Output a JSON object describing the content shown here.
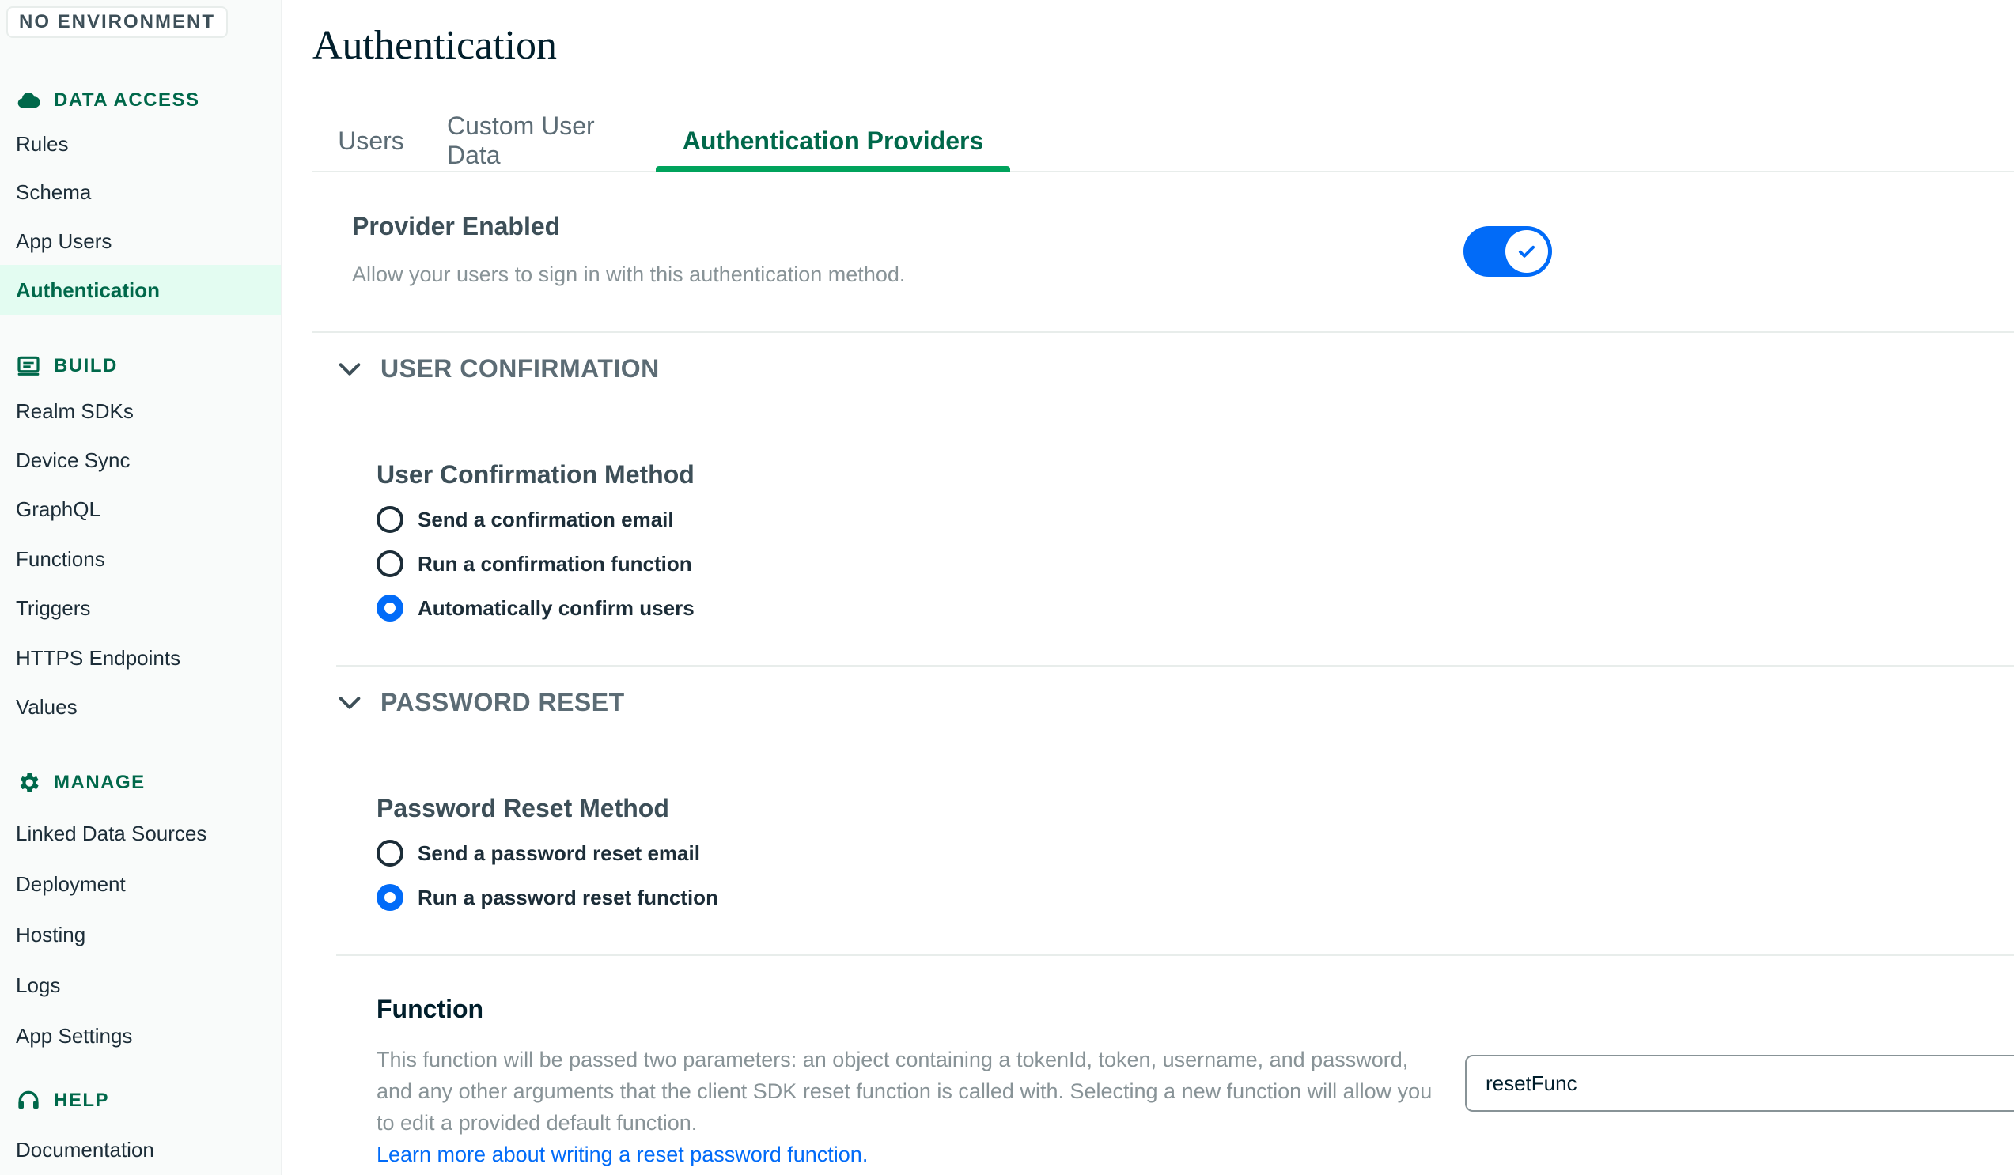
{
  "environment_badge": "NO ENVIRONMENT",
  "sidebar": {
    "sections": [
      {
        "label": "DATA ACCESS",
        "icon": "cloud-icon"
      },
      {
        "label": "BUILD",
        "icon": "monitor-icon"
      },
      {
        "label": "MANAGE",
        "icon": "gear-icon"
      },
      {
        "label": "HELP",
        "icon": "headset-icon"
      }
    ],
    "items": [
      "Rules",
      "Schema",
      "App Users",
      "Authentication",
      "Realm SDKs",
      "Device Sync",
      "GraphQL",
      "Functions",
      "Triggers",
      "HTTPS Endpoints",
      "Values",
      "Linked Data Sources",
      "Deployment",
      "Hosting",
      "Logs",
      "App Settings",
      "Documentation"
    ],
    "active_item": "Authentication"
  },
  "page": {
    "title": "Authentication"
  },
  "tabs": [
    "Users",
    "Custom User Data",
    "Authentication Providers"
  ],
  "active_tab": "Authentication Providers",
  "provider": {
    "title": "Provider Enabled",
    "description": "Allow your users to sign in with this authentication method.",
    "enabled": true
  },
  "user_confirmation": {
    "section_title": "USER CONFIRMATION",
    "method_title": "User Confirmation Method",
    "options": [
      "Send a confirmation email",
      "Run a confirmation function",
      "Automatically confirm users"
    ],
    "selected": "Automatically confirm users"
  },
  "password_reset": {
    "section_title": "PASSWORD RESET",
    "method_title": "Password Reset Method",
    "options": [
      "Send a password reset email",
      "Run a password reset function"
    ],
    "selected": "Run a password reset function"
  },
  "function": {
    "title": "Function",
    "description": "This function will be passed two parameters: an object containing a tokenId, token, username, and password, and any other arguments that the client SDK reset function is called with. Selecting a new function will allow you to edit a provided default function.",
    "link_text": "Learn more about writing a reset password function.",
    "value": "resetFunc"
  },
  "colors": {
    "brand_green": "#00684a",
    "accent_green": "#00a35c",
    "active_bg": "#e3fcf1",
    "primary_blue": "#016bf8"
  }
}
